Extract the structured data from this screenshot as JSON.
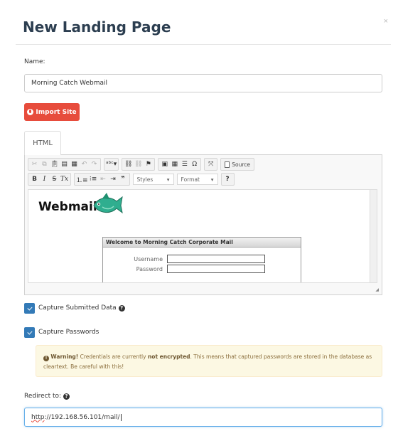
{
  "modal": {
    "title": "New Landing Page",
    "close_label": "×"
  },
  "name_field": {
    "label": "Name:",
    "value": "Morning Catch Webmail"
  },
  "import_button": {
    "label": "Import Site",
    "icon": "globe-icon",
    "color": "#e74c3c"
  },
  "tabs": [
    {
      "label": "HTML",
      "active": true
    }
  ],
  "editor": {
    "toolbar_row1": {
      "groups": [
        [
          "cut-icon",
          "copy-icon",
          "paste-icon",
          "paste-text-icon",
          "paste-word-icon",
          "undo-icon",
          "redo-icon"
        ],
        [
          "spellcheck-icon"
        ],
        [
          "link-icon",
          "unlink-icon",
          "anchor-icon"
        ],
        [
          "image-icon",
          "table-icon",
          "horizontal-rule-icon",
          "special-char-icon"
        ],
        [
          "maximize-icon"
        ],
        [
          "source-icon"
        ]
      ],
      "source_label": "Source"
    },
    "toolbar_row2": {
      "bold": "B",
      "italic": "I",
      "strike": "S",
      "remove_format": "Tx",
      "styles_label": "Styles",
      "format_label": "Format",
      "help": "?"
    },
    "content": {
      "logo_text": "Webmail",
      "login_box_title": "Welcome to Morning Catch Corporate Mail",
      "username_label": "Username",
      "password_label": "Password"
    }
  },
  "checkboxes": [
    {
      "label": "Capture Submitted Data",
      "checked": true,
      "has_help": true
    },
    {
      "label": "Capture Passwords",
      "checked": true,
      "has_help": false
    }
  ],
  "warning": {
    "title": "Warning!",
    "text_before": " Credentials are currently ",
    "emphasis": "not encrypted",
    "text_after": ". This means that captured passwords are stored in the database as cleartext. Be careful with this!"
  },
  "redirect": {
    "label": "Redirect to:",
    "value_prefix": "http",
    "value_rest": "://192.168.56.101/mail/"
  },
  "colors": {
    "accent": "#337ab7",
    "danger": "#e74c3c",
    "warning_bg": "#fcf8e3",
    "title": "#2c3e50"
  }
}
